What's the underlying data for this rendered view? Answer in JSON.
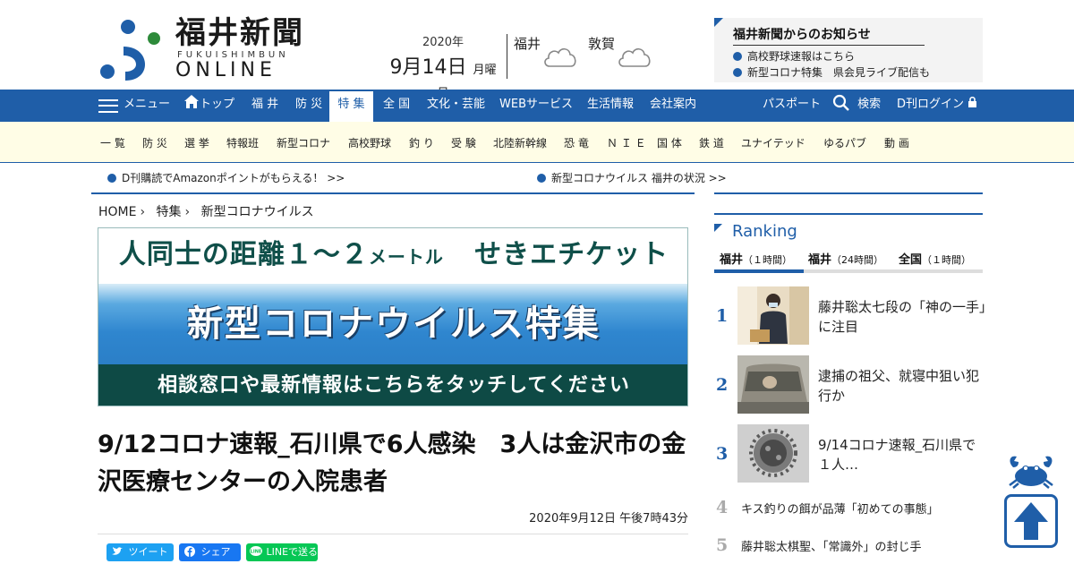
{
  "header": {
    "logo_jp": "福井新聞",
    "logo_romaji": "FUKUISHIMBUN",
    "logo_online": "ONLINE",
    "date_year": "2020年",
    "date_main": "9月14日",
    "date_weekday": "月曜日",
    "weather": [
      {
        "city": "福井",
        "icon": "cloud-icon"
      },
      {
        "city": "敦賀",
        "icon": "cloud-icon"
      }
    ],
    "notice": {
      "title": "福井新聞からのお知らせ",
      "items": [
        "高校野球速報はこちら",
        "新型コロナ特集　県会見ライブ配信も"
      ]
    }
  },
  "nav": {
    "menu_label": "メニュー",
    "items": [
      "トップ",
      "福 井",
      "防 災",
      "特 集",
      "全 国",
      "文化・芸能",
      "WEBサービス",
      "生活情報",
      "会社案内"
    ],
    "active_index": 3,
    "passport": "パスポート",
    "search": "検索",
    "login": "D刊ログイン"
  },
  "subnav": [
    "一 覧",
    "防 災",
    "選 挙",
    "特報班",
    "新型コロナ",
    "高校野球",
    "釣 り",
    "受 験",
    "北陸新幹線",
    "恐 竜",
    "Ｎ Ｉ Ｅ",
    "国 体",
    "鉄 道",
    "ユナイテッド",
    "ゆるパブ",
    "動 画"
  ],
  "tickers": [
    "D刊購読でAmazonポイントがもらえる！ >>",
    "新型コロナウイルス 福井の状況 >>"
  ],
  "breadcrumb": [
    "HOME",
    "特集",
    "新型コロナウイルス"
  ],
  "banner": {
    "top_a": "人同士の距離１～２",
    "top_unit": "メートル",
    "top_b": "せきエチケット",
    "middle": "新型コロナウイルス特集",
    "bottom": "相談窓口や最新情報はこちらをタッチしてください"
  },
  "article": {
    "headline": "9/12コロナ速報_石川県で6人感染　3人は金沢市の金沢医療センターの入院患者",
    "date": "2020年9月12日 午後7時43分"
  },
  "share": {
    "twitter": "ツイート",
    "facebook": "シェア",
    "line": "LINEで送る"
  },
  "ranking": {
    "title": "Ranking",
    "tabs": [
      {
        "label": "福井",
        "sub": "（１時間）"
      },
      {
        "label": "福井",
        "sub": "（24時間）"
      },
      {
        "label": "全国",
        "sub": "（１時間）"
      }
    ],
    "items": [
      {
        "rank": "1",
        "text": "藤井聡太七段の「神の一手」に注目"
      },
      {
        "rank": "2",
        "text": "逮捕の祖父、就寝中狙い犯行か"
      },
      {
        "rank": "3",
        "text": "9/14コロナ速報_石川県で１人…"
      },
      {
        "rank": "4",
        "text": "キス釣りの餌が品薄「初めての事態」"
      },
      {
        "rank": "5",
        "text": "藤井聡太棋聖、「常識外」の封じ手"
      }
    ]
  },
  "colors": {
    "brand_blue": "#1f5ea8",
    "subnav_bg": "#fffde6",
    "banner_green": "#0e4a45"
  }
}
